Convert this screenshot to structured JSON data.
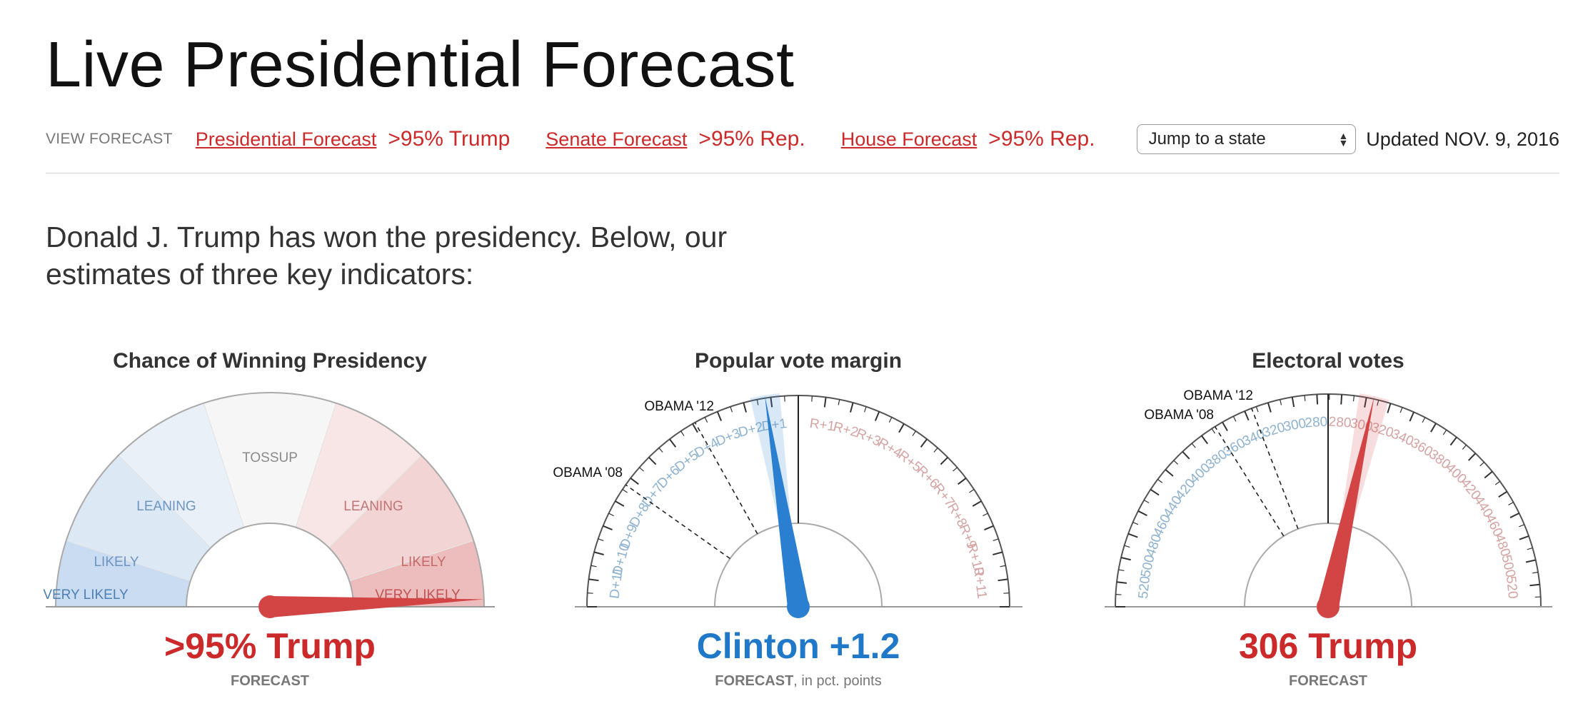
{
  "header": {
    "title": "Live Presidential Forecast",
    "view_label": "VIEW FORECAST",
    "links": [
      {
        "label": "Presidential Forecast",
        "value": ">95% Trump"
      },
      {
        "label": "Senate Forecast",
        "value": ">95% Rep."
      },
      {
        "label": "House Forecast",
        "value": ">95% Rep."
      }
    ],
    "state_select": {
      "selected": "Jump to a state"
    },
    "updated": "Updated NOV. 9, 2016"
  },
  "intro": "Donald J. Trump has won the presidency. Below, our estimates of three key indicators:",
  "colors": {
    "red": "#d34545",
    "blue": "#2a7fd0",
    "red_text": "#cc2a2a",
    "blue_text": "#1f78c8"
  },
  "chart_data": [
    {
      "type": "gauge",
      "title": "Chance of Winning Presidency",
      "zones": [
        {
          "label": "VERY LIKELY",
          "side": "dem"
        },
        {
          "label": "LIKELY",
          "side": "dem"
        },
        {
          "label": "LEANING",
          "side": "dem"
        },
        {
          "label": "TOSSUP",
          "side": "neutral"
        },
        {
          "label": "LEANING",
          "side": "rep"
        },
        {
          "label": "LIKELY",
          "side": "rep"
        },
        {
          "label": "VERY LIKELY",
          "side": "rep"
        }
      ],
      "value": ">95% Trump",
      "trump_probability": 0.99,
      "sublabel": "FORECAST"
    },
    {
      "type": "gauge",
      "title": "Popular vote margin",
      "range": [
        -12,
        12
      ],
      "tick_labels": [
        "D+11",
        "D+10",
        "D+9",
        "D+8",
        "D+7",
        "D+6",
        "D+5",
        "D+4",
        "D+3",
        "D+2",
        "D+1",
        "R+1",
        "R+2",
        "R+3",
        "R+4",
        "R+5",
        "R+6",
        "R+7",
        "R+8",
        "R+9",
        "R+10",
        "R+11"
      ],
      "reference_markers": [
        {
          "label": "OBAMA '12",
          "value": -3.9
        },
        {
          "label": "OBAMA '08",
          "value": -7.3
        }
      ],
      "forecast_value": -1.2,
      "value": "Clinton +1.2",
      "sublabel_bold": "FORECAST",
      "sublabel_rest": ", in pct. points"
    },
    {
      "type": "gauge",
      "title": "Electoral votes",
      "range": [
        538,
        0
      ],
      "dem_tick_labels": [
        "520",
        "500",
        "480",
        "460",
        "440",
        "420",
        "400",
        "380",
        "360",
        "340",
        "320",
        "300",
        "280"
      ],
      "rep_tick_labels": [
        "280",
        "300",
        "320",
        "340",
        "360",
        "380",
        "400",
        "420",
        "440",
        "460",
        "480",
        "500",
        "520"
      ],
      "reference_markers": [
        {
          "label": "OBAMA '12",
          "value": 332
        },
        {
          "label": "OBAMA '08",
          "value": 365
        }
      ],
      "trump_electoral_votes": 306,
      "value": "306 Trump",
      "sublabel": "FORECAST"
    }
  ]
}
